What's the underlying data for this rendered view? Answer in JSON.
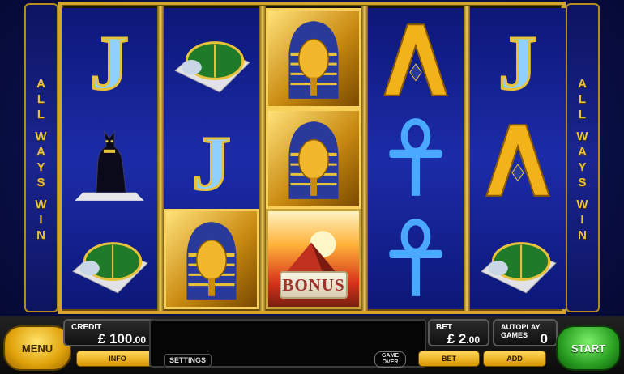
{
  "sidebar": {
    "left_text": [
      "A",
      "L",
      "L",
      "",
      "W",
      "A",
      "Y",
      "S",
      "",
      "W",
      "I",
      "N"
    ],
    "right_text": [
      "A",
      "L",
      "L",
      "",
      "W",
      "A",
      "Y",
      "S",
      "",
      "W",
      "I",
      "N"
    ]
  },
  "reels": [
    [
      "symbol-j-icon",
      "bastet-cat-icon",
      "scarab-icon"
    ],
    [
      "scarab-icon",
      "symbol-j-icon",
      "pharaoh-mask-icon"
    ],
    [
      "pharaoh-mask-icon",
      "pharaoh-mask-icon",
      "bonus-pyramid-icon"
    ],
    [
      "symbol-a-icon",
      "ankh-icon",
      "ankh-icon"
    ],
    [
      "symbol-j-icon",
      "symbol-a-icon",
      "scarab-icon"
    ]
  ],
  "bonus": {
    "label": "BONUS"
  },
  "controls": {
    "menu_label": "MENU",
    "info_label": "INFO",
    "settings_label": "SETTINGS",
    "game_over_line1": "GAME",
    "game_over_line2": "OVER",
    "bet_button_label": "BET",
    "add_button_label": "ADD",
    "start_label": "START"
  },
  "credit": {
    "label": "CREDIT",
    "currency": "£",
    "value": "100",
    "decimals": ".00"
  },
  "bet": {
    "label": "BET",
    "currency": "£",
    "value": "2",
    "decimals": ".00"
  },
  "autoplay": {
    "label": "AUTOPLAY GAMES",
    "value": "0"
  },
  "colors": {
    "gold": "#d4a52a",
    "reel_blue": "#1c2ca8",
    "menu_yellow": "#e0a20a",
    "start_green": "#2aa022"
  }
}
